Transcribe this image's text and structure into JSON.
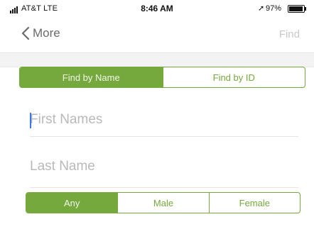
{
  "status_bar": {
    "carrier": "AT&T  LTE",
    "time": "8:46 AM",
    "location_icon": "location-arrow-icon",
    "battery_percent": "97%",
    "battery_level": 0.97
  },
  "nav": {
    "back_label": "More",
    "action_label": "Find"
  },
  "search_mode": {
    "options": [
      "Find by Name",
      "Find by ID"
    ],
    "selected": "Find by Name"
  },
  "fields": {
    "first_name_placeholder": "First Names",
    "last_name_placeholder": "Last Name"
  },
  "gender": {
    "options": [
      "Any",
      "Male",
      "Female"
    ],
    "selected": "Any"
  },
  "colors": {
    "accent": "#75a83d",
    "caret": "#3478f6"
  }
}
